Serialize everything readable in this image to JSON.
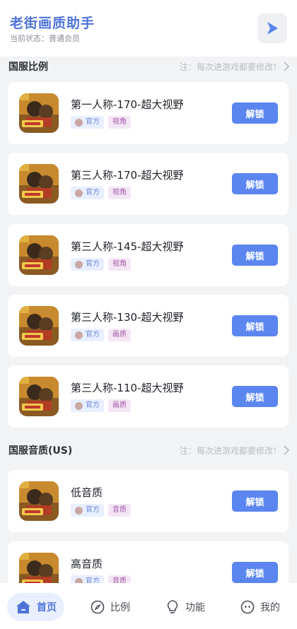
{
  "header": {
    "title": "老街画质助手",
    "status": "当前状态：普通会员",
    "play_icon": "play-triangle-icon"
  },
  "colors": {
    "accent": "#5b86f0",
    "title_blue": "#4f74d8",
    "tag_official_bg": "#e8efff",
    "tag_type_bg": "#f5e6f6",
    "page_bg": "#f2f3f5"
  },
  "sections": [
    {
      "title": "国服比例",
      "note": "注：每次进游戏都要修改！",
      "items": [
        {
          "name": "第一人称-170-超大视野",
          "tag1": "官方",
          "tag2": "视角",
          "action": "解锁"
        },
        {
          "name": "第三人称-170-超大视野",
          "tag1": "官方",
          "tag2": "视角",
          "action": "解锁"
        },
        {
          "name": "第三人称-145-超大视野",
          "tag1": "官方",
          "tag2": "视角",
          "action": "解锁"
        },
        {
          "name": "第三人称-130-超大视野",
          "tag1": "官方",
          "tag2": "画质",
          "action": "解锁"
        },
        {
          "name": "第三人称-110-超大视野",
          "tag1": "官方",
          "tag2": "画质",
          "action": "解锁"
        }
      ]
    },
    {
      "title": "国服音质(US)",
      "note": "注：每次进游戏都要修改！",
      "items": [
        {
          "name": "低音质",
          "tag1": "官方",
          "tag2": "音质",
          "action": "解锁"
        },
        {
          "name": "高音质",
          "tag1": "官方",
          "tag2": "音质",
          "action": "解锁"
        }
      ]
    }
  ],
  "tabbar": {
    "tabs": [
      {
        "label": "首页",
        "icon": "home-icon",
        "active": true
      },
      {
        "label": "比例",
        "icon": "compass-icon",
        "active": false
      },
      {
        "label": "功能",
        "icon": "lightbulb-icon",
        "active": false
      },
      {
        "label": "我的",
        "icon": "face-icon",
        "active": false
      }
    ]
  }
}
